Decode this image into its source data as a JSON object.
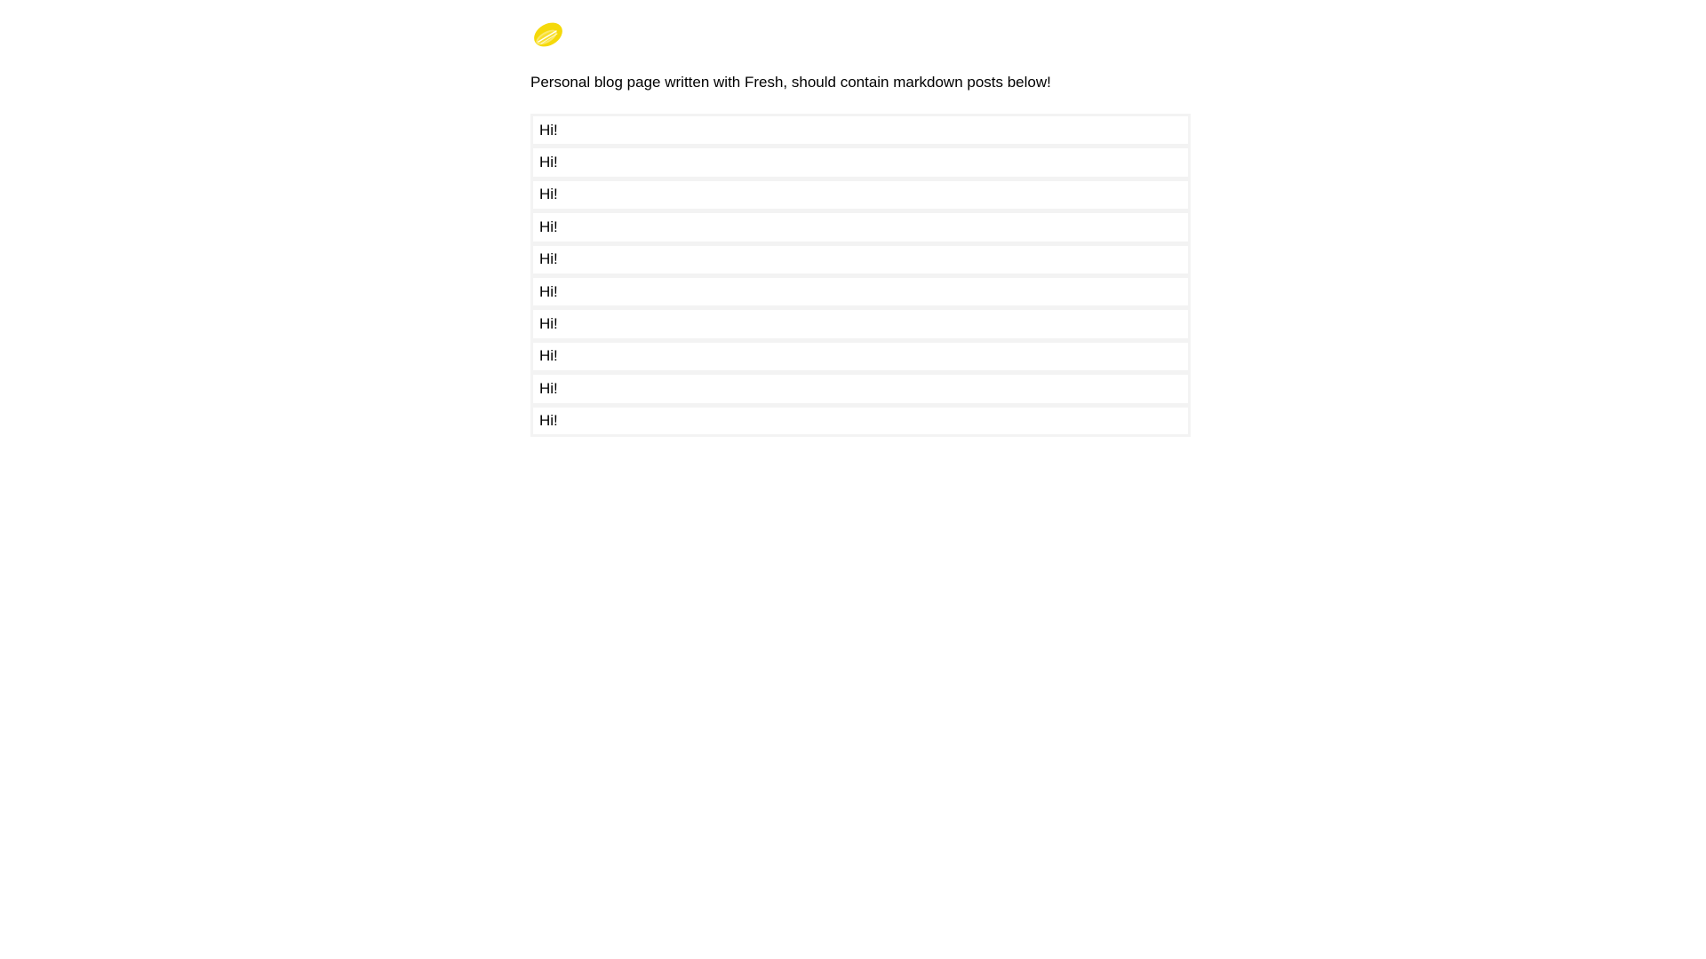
{
  "logo": {
    "icon": "lemon-icon",
    "color": "#f5d90a"
  },
  "intro": {
    "text": "Personal blog page written with Fresh, should contain markdown posts below!"
  },
  "posts": [
    {
      "title": "Hi!"
    },
    {
      "title": "Hi!"
    },
    {
      "title": "Hi!"
    },
    {
      "title": "Hi!"
    },
    {
      "title": "Hi!"
    },
    {
      "title": "Hi!"
    },
    {
      "title": "Hi!"
    },
    {
      "title": "Hi!"
    },
    {
      "title": "Hi!"
    },
    {
      "title": "Hi!"
    }
  ]
}
